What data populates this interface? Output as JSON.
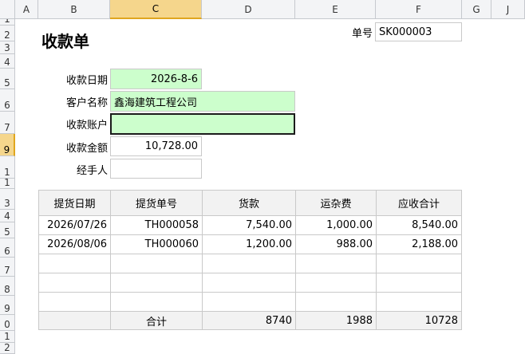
{
  "columns": [
    "A",
    "B",
    "C",
    "D",
    "E",
    "F",
    "G",
    "J"
  ],
  "row_numbers": [
    "1",
    "2",
    "3",
    "4",
    "5",
    "6",
    "7",
    "9",
    "1",
    "1",
    "3",
    "4",
    "5",
    "6",
    "7",
    "8",
    "9",
    "0",
    "1",
    "2"
  ],
  "header": {
    "title": "收款单",
    "doc_no_label": "单号",
    "doc_no_value": "SK000003"
  },
  "form": {
    "date_label": "收款日期",
    "date_value": "2026-8-6",
    "customer_label": "客户名称",
    "customer_value": "鑫海建筑工程公司",
    "account_label": "收款账户",
    "account_value": "",
    "amount_label": "收款金额",
    "amount_value": "10,728.00",
    "handler_label": "经手人",
    "handler_value": ""
  },
  "table": {
    "headers": [
      "提货日期",
      "提货单号",
      "货款",
      "运杂费",
      "应收合计"
    ],
    "rows": [
      [
        "2026/07/26",
        "TH000058",
        "7,540.00",
        "1,000.00",
        "8,540.00"
      ],
      [
        "2026/08/06",
        "TH000060",
        "1,200.00",
        "988.00",
        "2,188.00"
      ],
      [
        "",
        "",
        "",
        "",
        ""
      ],
      [
        "",
        "",
        "",
        "",
        ""
      ],
      [
        "",
        "",
        "",
        "",
        ""
      ]
    ],
    "footer": [
      "",
      "合计",
      "8740",
      "1988",
      "10728"
    ]
  },
  "colors": {
    "input_fill": "#ccfecc",
    "header_active": "#f5d68c"
  }
}
